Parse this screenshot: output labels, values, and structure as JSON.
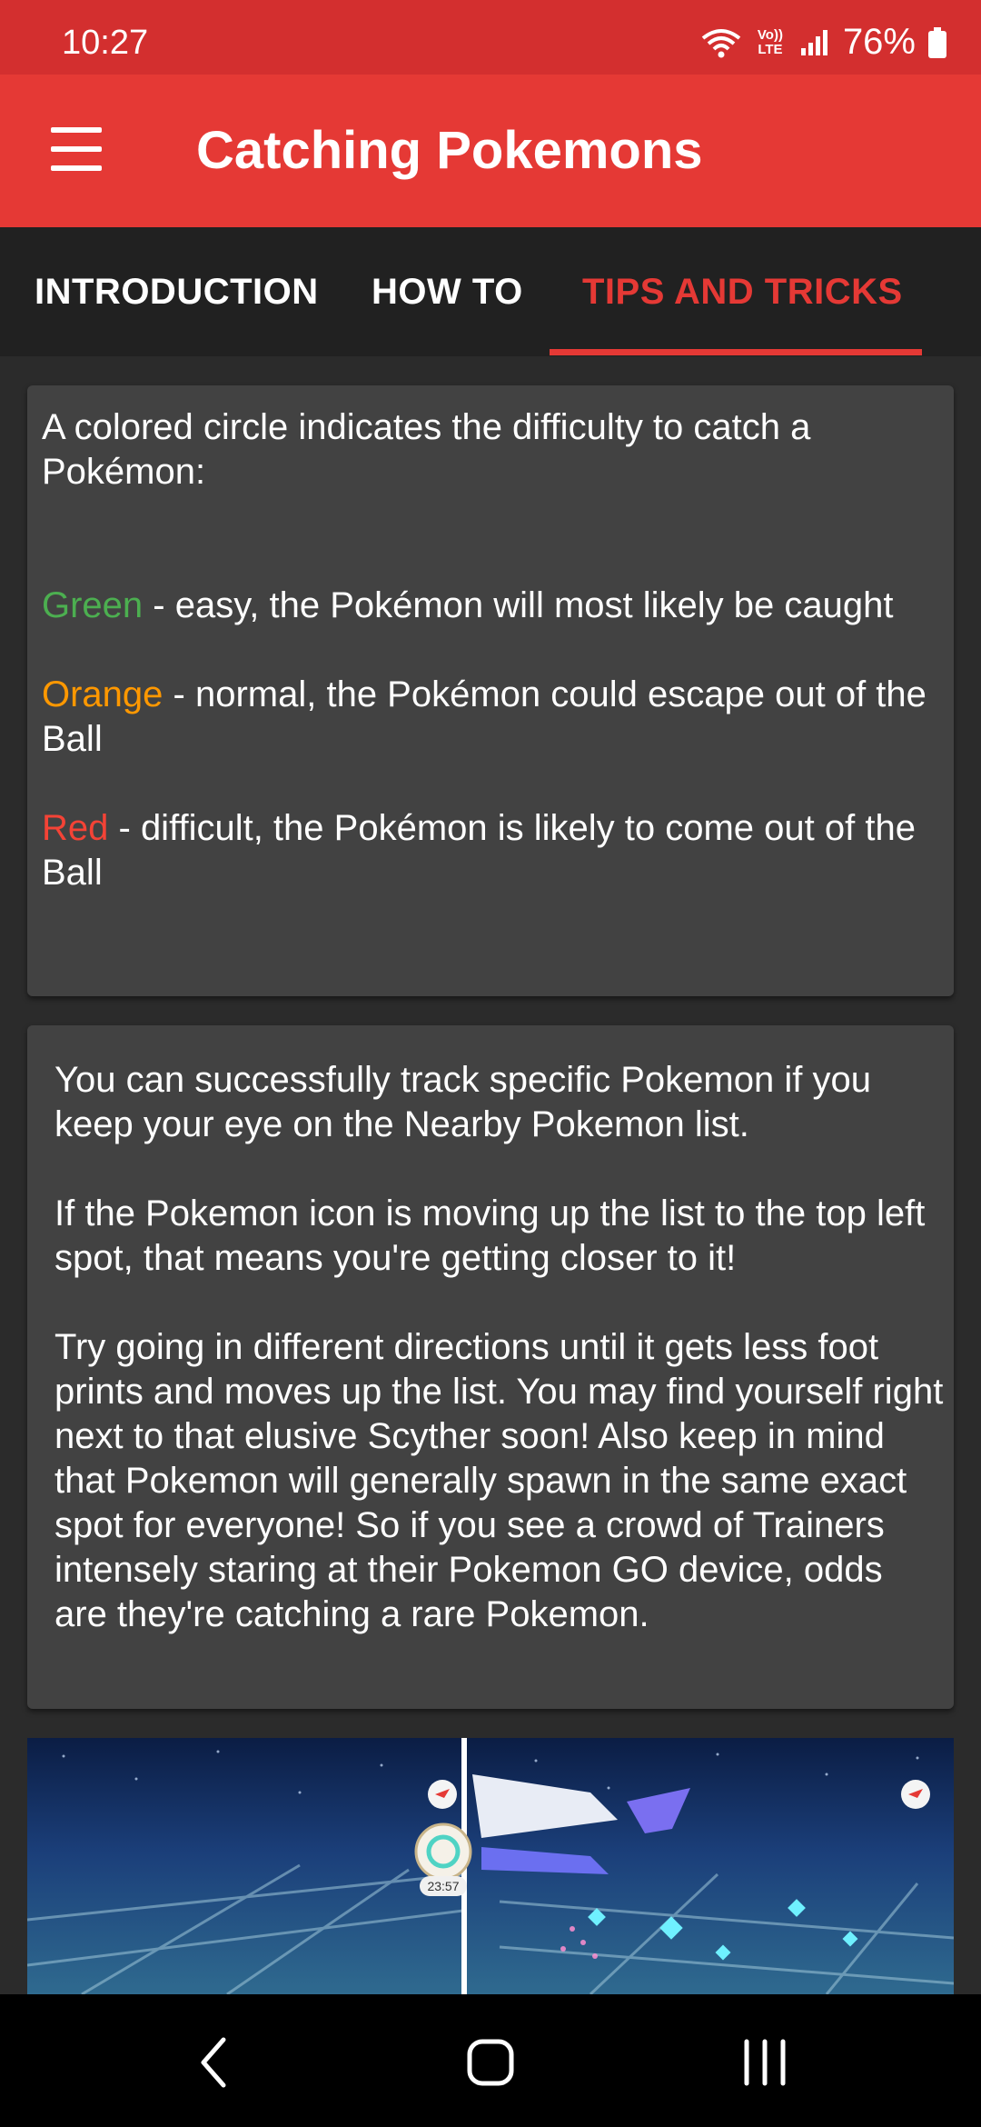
{
  "status": {
    "time": "10:27",
    "volte": "Vo)) LTE",
    "battery": "76%"
  },
  "appbar": {
    "title": "Catching Pokemons"
  },
  "tabs": [
    {
      "label": "INTRODUCTION",
      "active": false
    },
    {
      "label": "HOW TO",
      "active": false
    },
    {
      "label": "TIPS AND TRICKS",
      "active": true
    }
  ],
  "card1": {
    "intro": "A colored circle indicates the difficulty to catch a Pokémon:",
    "items": [
      {
        "color_word": "Green",
        "color": "#4caf50",
        "text": " - easy, the Pokémon will most likely be caught"
      },
      {
        "color_word": "Orange",
        "color": "#ff9800",
        "text": " - normal, the Pokémon could escape out of the Ball"
      },
      {
        "color_word": "Red",
        "color": "#f44336",
        "text": " - difficult, the Pokémon is likely to come out of the Ball"
      }
    ]
  },
  "card2": {
    "p1": "You can successfully track specific Pokemon if you keep your eye on the Nearby Pokemon list.",
    "p2": "If the Pokemon icon is moving up the list to the top left spot, that means you're getting closer to it!",
    "p3": "Try going in different directions until it gets less foot prints and moves up the list. You may find yourself right next to that elusive Scyther soon! Also keep in mind that Pokemon will generally spawn in the same exact spot for everyone! So if you see a crowd of Trainers intensely staring at their Pokemon GO device, odds are they're catching a rare Pokemon."
  },
  "screenshot": {
    "timer": "23:57"
  },
  "colors": {
    "statusbar": "#d32f2f",
    "appbar": "#e53935",
    "tabs_bg": "#212121",
    "card_bg": "#424242",
    "accent": "#e53935"
  }
}
